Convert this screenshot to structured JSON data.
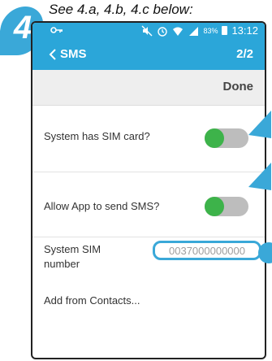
{
  "step": {
    "number": "4",
    "caption": "See 4.a, 4.b, 4.c below:"
  },
  "status_bar": {
    "battery": "83%",
    "time": "13:12",
    "icons": [
      "key-icon",
      "mute-icon",
      "alarm-icon",
      "wifi-icon",
      "signal-icon",
      "battery-icon"
    ]
  },
  "app_bar": {
    "title": "SMS",
    "page_indicator": "2/2"
  },
  "toolbar": {
    "done_label": "Done"
  },
  "settings": {
    "sim_card": {
      "label": "System has SIM card?",
      "enabled": true
    },
    "send_sms": {
      "label": "Allow App to send SMS?",
      "enabled": true
    },
    "sim_number": {
      "label": "System SIM number",
      "value": "0037000000000"
    },
    "add_contacts": "Add from Contacts..."
  },
  "colors": {
    "accent": "#2ba6d9",
    "toggle_on": "#3db34a",
    "toggle_track": "#bdbdbd"
  }
}
